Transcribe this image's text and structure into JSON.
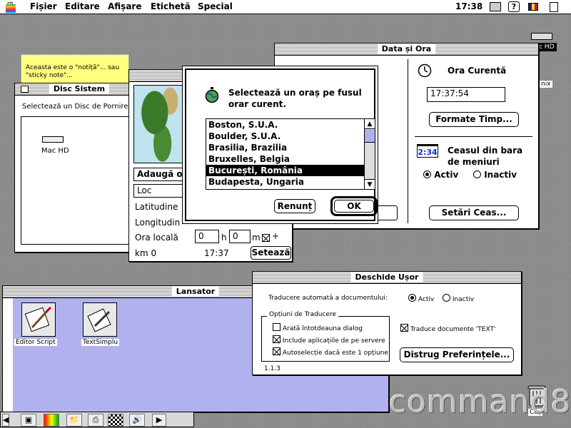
{
  "menubar": {
    "items": [
      "Fișier",
      "Editare",
      "Afișare",
      "Etichetă",
      "Special"
    ],
    "clock": "17:38"
  },
  "desktop": {
    "disk_label": "c HD",
    "partial_label": "nix",
    "trash_label": "Coș"
  },
  "sticky": {
    "text": "Aceasta este o \"notiță\"... sau \"sticky note\"..."
  },
  "disc_sistem": {
    "title": "Disc Sistem",
    "prompt": "Selectează un Disc de Pornire:",
    "disk": "Mac HD"
  },
  "map_cp": {
    "add_button": "Adaugă or",
    "loc_field": "Loc",
    "latitude_label": "Latitudine",
    "longitude_label": "Longitudin",
    "local_time_label": "Ora locală",
    "hour_value": "0",
    "h_label": "h",
    "min_value": "0",
    "m_label": "m",
    "plus": "+",
    "km_label": "km 0",
    "time_value": "17:37",
    "set_button": "Setează"
  },
  "data_ora": {
    "title": "Data și Ora",
    "current_time_label": "Ora Curentă",
    "time_value": "17:37:54",
    "formats_button": "Formate Timp...",
    "menubar_clock_icon": "2:34",
    "menubar_clock_label": "Ceasul din bara de meniuri",
    "active_label": "Activ",
    "inactive_label": "Inactiv",
    "clock_settings_button": "Setări Ceas..."
  },
  "dialog": {
    "prompt": "Selectează un oraș pe fusul orar curent.",
    "cities": [
      "Boston, S.U.A.",
      "Boulder, S.U.A.",
      "Brasilia, Brazilia",
      "Bruxelles, Belgia",
      "București, România",
      "Budapesta, Ungaria"
    ],
    "selected_index": 4,
    "cancel_button": "Renunț",
    "ok_button": "OK"
  },
  "deschide_usor": {
    "title": "Deschide Ușor",
    "auto_translate_label": "Traducere automată a documentului:",
    "active_label": "Activ",
    "inactive_label": "Inactiv",
    "group_label": "Opțiuni de Traducere",
    "opt_always_dialog": "Arată întotdeauna dialog",
    "opt_include_server": "Include aplicațiile de pe servere",
    "opt_autoselect": "Autoselecție dacă este 1 opțiune",
    "opt_text_docs": "Traduce documente 'TEXT'",
    "destroy_prefs_button": "Distrug Preferințele...",
    "version": "1.1.3"
  },
  "lansator": {
    "title": "Lansator",
    "items": [
      "Editor Script",
      "TextSimplu"
    ]
  },
  "watermark": "command8"
}
